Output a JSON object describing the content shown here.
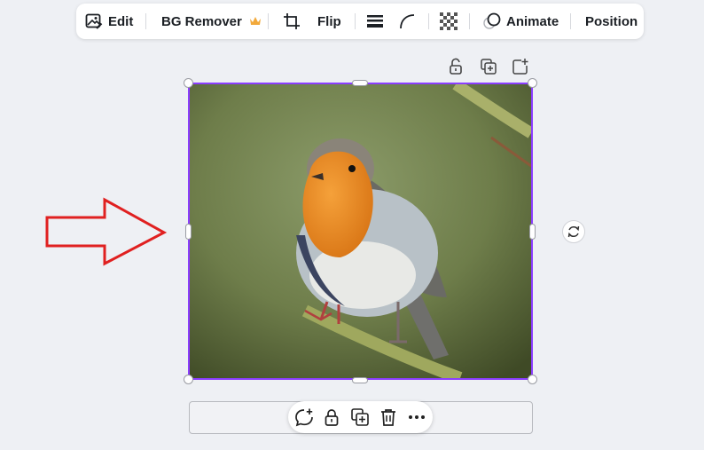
{
  "toolbar": {
    "edit_label": "Edit",
    "bg_remover_label": "BG Remover",
    "flip_label": "Flip",
    "animate_label": "Animate",
    "position_label": "Position"
  },
  "colors": {
    "selection": "#8b3dff",
    "crown": "#f2a93b",
    "annotation_arrow": "#e02020"
  },
  "icons": {
    "edit": "image-edit-icon",
    "bg_remover_badge": "crown-icon",
    "crop": "crop-icon",
    "border": "border-weight-icon",
    "corner": "corner-rounding-icon",
    "transparency": "transparency-icon",
    "animate": "animate-icon",
    "lock": "lock-icon",
    "duplicate": "duplicate-icon",
    "add": "add-page-icon",
    "rotate": "rotate-icon",
    "comment": "comment-add-icon",
    "trash": "trash-icon",
    "more": "more-icon"
  }
}
